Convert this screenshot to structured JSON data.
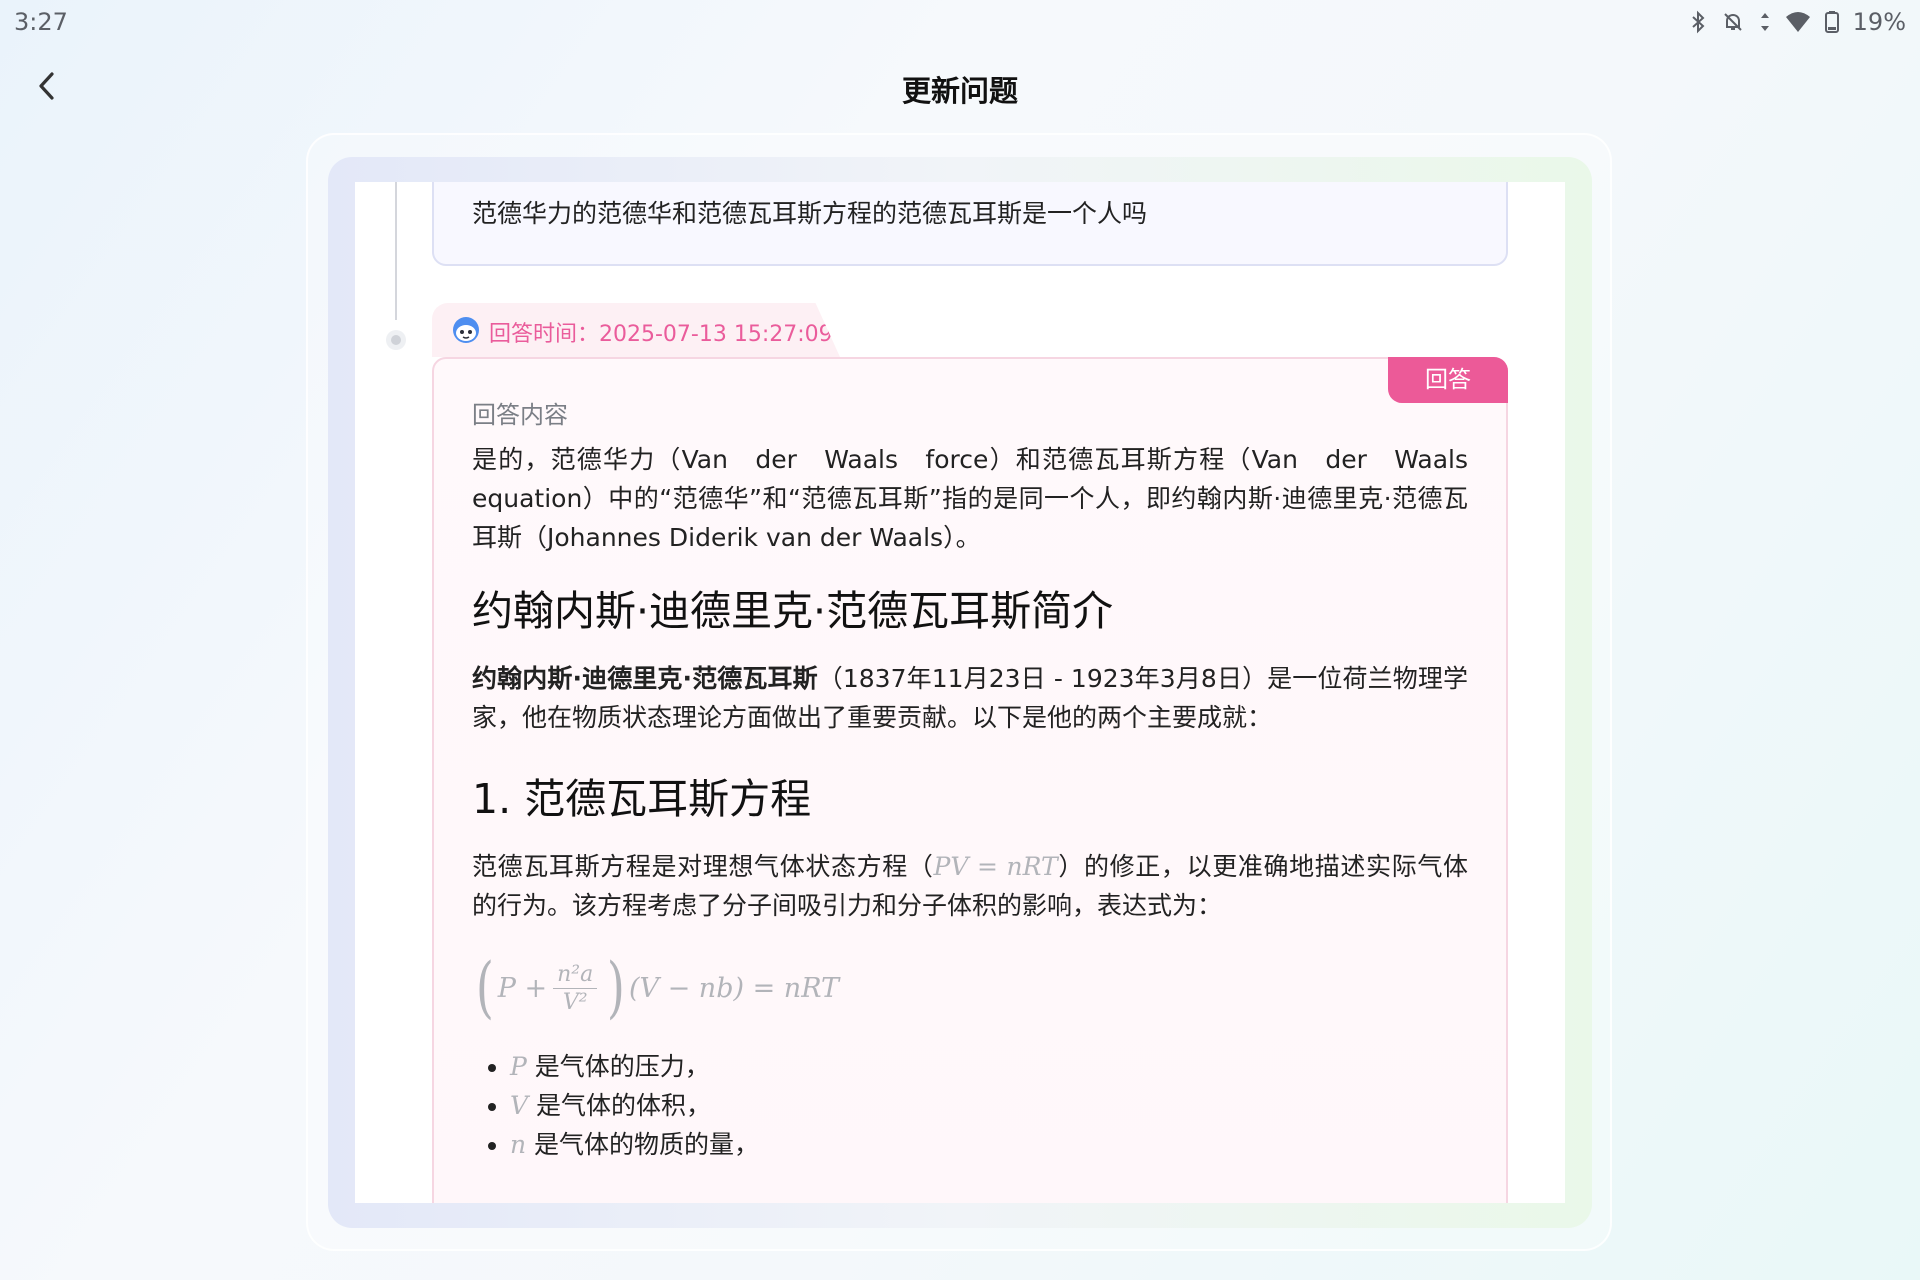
{
  "status_bar": {
    "time": "3:27",
    "battery": "19%",
    "icons": [
      "bluetooth-icon",
      "bell-off-icon",
      "data-arrows-icon",
      "wifi-icon",
      "battery-icon"
    ]
  },
  "header": {
    "title": "更新问题",
    "back_icon": "chevron-left-icon"
  },
  "question": {
    "text": "范德华力的范德华和范德瓦耳斯方程的范德瓦耳斯是一个人吗"
  },
  "answer": {
    "time_label": "回答时间：2025-07-13 15:27:09",
    "badge": "回答",
    "content_label": "回答内容",
    "intro": "是的，范德华力（Van　der　Waals　force）和范德瓦耳斯方程（Van　der　Waals equation）中的“范德华”和“范德瓦耳斯”指的是同一个人，即约翰内斯·迪德里克·范德瓦耳斯（Johannes Diderik van der Waals）。",
    "heading1": "约翰内斯·迪德里克·范德瓦耳斯简介",
    "bio_name": "约翰内斯·迪德里克·范德瓦耳斯",
    "bio_rest": "（1837年11月23日 - 1923年3月8日）是一位荷兰物理学家，他在物质状态理论方面做出了重要贡献。以下是他的两个主要成就：",
    "heading2": "1. 范德瓦耳斯方程",
    "eq_text_before": "范德瓦耳斯方程是对理想气体状态方程（",
    "eq_inline": "PV = nRT",
    "eq_text_after": "）的修正，以更准确地描述实际气体的行为。该方程考虑了分子间吸引力和分子体积的影响，表达式为：",
    "formula": {
      "P": "P +",
      "num": "n²a",
      "den": "V²",
      "rest": "(V − nb) = nRT"
    },
    "bullets": [
      {
        "var": "P",
        "text": " 是气体的压力，"
      },
      {
        "var": "V",
        "text": " 是气体的体积，"
      },
      {
        "var": "n",
        "text": " 是气体的物质的量，"
      }
    ]
  }
}
